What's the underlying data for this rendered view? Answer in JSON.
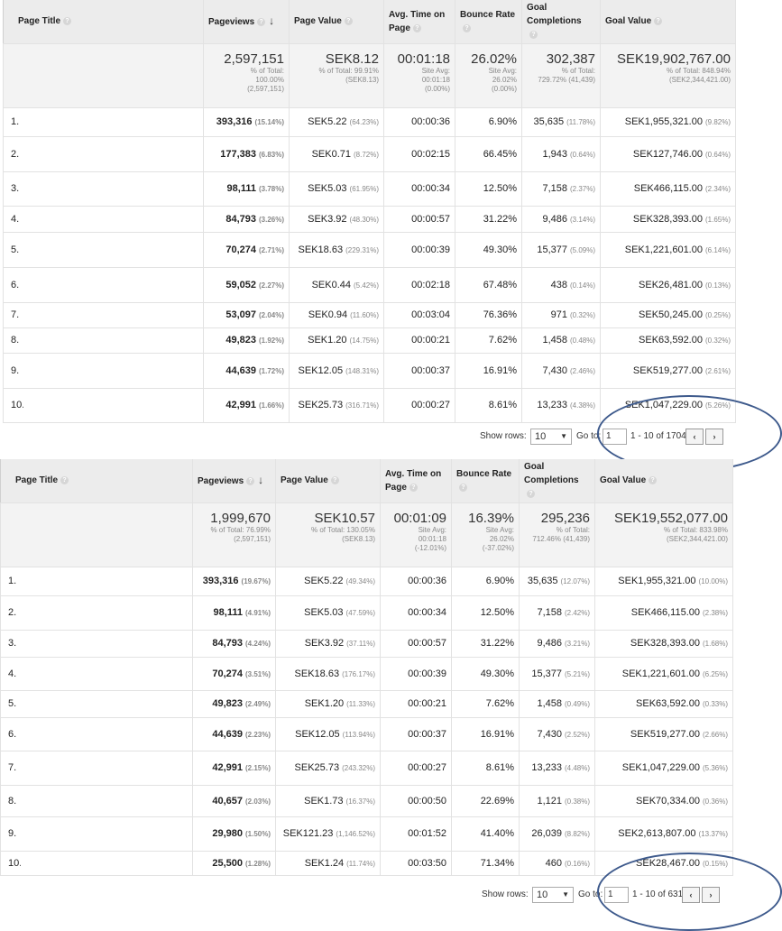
{
  "headers": {
    "page_title": "Page Title",
    "pageviews": "Pageviews",
    "page_value": "Page Value",
    "avg_time": "Avg. Time on Page",
    "bounce_rate": "Bounce Rate",
    "goal_completions": "Goal Completions",
    "goal_value": "Goal Value",
    "help_icon": "?",
    "sort_icon": "↓"
  },
  "colors": {
    "circle": "#3e5a8c",
    "header_bg": "#ececec",
    "summary_bg": "#f3f3f3"
  },
  "table1": {
    "summary": {
      "pageviews": "2,597,151",
      "pageviews_sub1": "% of Total:",
      "pageviews_sub2": "100.00%",
      "pageviews_sub3": "(2,597,151)",
      "page_value": "SEK8.12",
      "page_value_sub1": "% of Total: 99.91%",
      "page_value_sub2": "(SEK8.13)",
      "avg_time": "00:01:18",
      "avg_time_sub1": "Site Avg:",
      "avg_time_sub2": "00:01:18",
      "avg_time_sub3": "(0.00%)",
      "bounce": "26.02%",
      "bounce_sub1": "Site Avg:",
      "bounce_sub2": "26.02%",
      "bounce_sub3": "(0.00%)",
      "goals": "302,387",
      "goals_sub1": "% of Total:",
      "goals_sub2": "729.72% (41,439)",
      "goal_value": "SEK19,902,767.00",
      "goal_value_sub1": "% of Total: 848.94%",
      "goal_value_sub2": "(SEK2,344,421.00)"
    },
    "rows": [
      {
        "idx": "1.",
        "pv": "393,316",
        "pv_pct": "(15.14%)",
        "val": "SEK5.22",
        "val_pct": "(64.23%)",
        "time": "00:00:36",
        "bounce": "6.90%",
        "goals": "35,635",
        "goals_pct": "(11.78%)",
        "gv": "SEK1,955,321.00",
        "gv_pct": "(9.82%)"
      },
      {
        "idx": "2.",
        "pv": "177,383",
        "pv_pct": "(6.83%)",
        "val": "SEK0.71",
        "val_pct": "(8.72%)",
        "time": "00:02:15",
        "bounce": "66.45%",
        "goals": "1,943",
        "goals_pct": "(0.64%)",
        "gv": "SEK127,746.00",
        "gv_pct": "(0.64%)"
      },
      {
        "idx": "3.",
        "pv": "98,111",
        "pv_pct": "(3.78%)",
        "val": "SEK5.03",
        "val_pct": "(61.95%)",
        "time": "00:00:34",
        "bounce": "12.50%",
        "goals": "7,158",
        "goals_pct": "(2.37%)",
        "gv": "SEK466,115.00",
        "gv_pct": "(2.34%)"
      },
      {
        "idx": "4.",
        "pv": "84,793",
        "pv_pct": "(3.26%)",
        "val": "SEK3.92",
        "val_pct": "(48.30%)",
        "time": "00:00:57",
        "bounce": "31.22%",
        "goals": "9,486",
        "goals_pct": "(3.14%)",
        "gv": "SEK328,393.00",
        "gv_pct": "(1.65%)"
      },
      {
        "idx": "5.",
        "pv": "70,274",
        "pv_pct": "(2.71%)",
        "val": "SEK18.63",
        "val_pct": "(229.31%)",
        "time": "00:00:39",
        "bounce": "49.30%",
        "goals": "15,377",
        "goals_pct": "(5.09%)",
        "gv": "SEK1,221,601.00",
        "gv_pct": "(6.14%)"
      },
      {
        "idx": "6.",
        "pv": "59,052",
        "pv_pct": "(2.27%)",
        "val": "SEK0.44",
        "val_pct": "(5.42%)",
        "time": "00:02:18",
        "bounce": "67.48%",
        "goals": "438",
        "goals_pct": "(0.14%)",
        "gv": "SEK26,481.00",
        "gv_pct": "(0.13%)"
      },
      {
        "idx": "7.",
        "pv": "53,097",
        "pv_pct": "(2.04%)",
        "val": "SEK0.94",
        "val_pct": "(11.60%)",
        "time": "00:03:04",
        "bounce": "76.36%",
        "goals": "971",
        "goals_pct": "(0.32%)",
        "gv": "SEK50,245.00",
        "gv_pct": "(0.25%)"
      },
      {
        "idx": "8.",
        "pv": "49,823",
        "pv_pct": "(1.92%)",
        "val": "SEK1.20",
        "val_pct": "(14.75%)",
        "time": "00:00:21",
        "bounce": "7.62%",
        "goals": "1,458",
        "goals_pct": "(0.48%)",
        "gv": "SEK63,592.00",
        "gv_pct": "(0.32%)"
      },
      {
        "idx": "9.",
        "pv": "44,639",
        "pv_pct": "(1.72%)",
        "val": "SEK12.05",
        "val_pct": "(148.31%)",
        "time": "00:00:37",
        "bounce": "16.91%",
        "goals": "7,430",
        "goals_pct": "(2.46%)",
        "gv": "SEK519,277.00",
        "gv_pct": "(2.61%)"
      },
      {
        "idx": "10.",
        "pv": "42,991",
        "pv_pct": "(1.66%)",
        "val": "SEK25.73",
        "val_pct": "(316.71%)",
        "time": "00:00:27",
        "bounce": "8.61%",
        "goals": "13,233",
        "goals_pct": "(4.38%)",
        "gv": "SEK1,047,229.00",
        "gv_pct": "(5.26%)"
      }
    ],
    "pager": {
      "show_rows_label": "Show rows:",
      "rows_value": "10",
      "goto_label": "Go to:",
      "goto_value": "1",
      "range": "1 - 10 of 1704",
      "prev": "‹",
      "next": "›"
    }
  },
  "table2": {
    "summary": {
      "pageviews": "1,999,670",
      "pageviews_sub1": "% of Total: 76.99%",
      "pageviews_sub2": "(2,597,151)",
      "page_value": "SEK10.57",
      "page_value_sub1": "% of Total: 130.05%",
      "page_value_sub2": "(SEK8.13)",
      "avg_time": "00:01:09",
      "avg_time_sub1": "Site Avg:",
      "avg_time_sub2": "00:01:18",
      "avg_time_sub3": "(-12.01%)",
      "bounce": "16.39%",
      "bounce_sub1": "Site Avg:",
      "bounce_sub2": "26.02%",
      "bounce_sub3": "(-37.02%)",
      "goals": "295,236",
      "goals_sub1": "% of Total:",
      "goals_sub2": "712.46% (41,439)",
      "goal_value": "SEK19,552,077.00",
      "goal_value_sub1": "% of Total: 833.98%",
      "goal_value_sub2": "(SEK2,344,421.00)"
    },
    "rows": [
      {
        "idx": "1.",
        "pv": "393,316",
        "pv_pct": "(19.67%)",
        "val": "SEK5.22",
        "val_pct": "(49.34%)",
        "time": "00:00:36",
        "bounce": "6.90%",
        "goals": "35,635",
        "goals_pct": "(12.07%)",
        "gv": "SEK1,955,321.00",
        "gv_pct": "(10.00%)"
      },
      {
        "idx": "2.",
        "pv": "98,111",
        "pv_pct": "(4.91%)",
        "val": "SEK5.03",
        "val_pct": "(47.59%)",
        "time": "00:00:34",
        "bounce": "12.50%",
        "goals": "7,158",
        "goals_pct": "(2.42%)",
        "gv": "SEK466,115.00",
        "gv_pct": "(2.38%)"
      },
      {
        "idx": "3.",
        "pv": "84,793",
        "pv_pct": "(4.24%)",
        "val": "SEK3.92",
        "val_pct": "(37.11%)",
        "time": "00:00:57",
        "bounce": "31.22%",
        "goals": "9,486",
        "goals_pct": "(3.21%)",
        "gv": "SEK328,393.00",
        "gv_pct": "(1.68%)"
      },
      {
        "idx": "4.",
        "pv": "70,274",
        "pv_pct": "(3.51%)",
        "val": "SEK18.63",
        "val_pct": "(176.17%)",
        "time": "00:00:39",
        "bounce": "49.30%",
        "goals": "15,377",
        "goals_pct": "(5.21%)",
        "gv": "SEK1,221,601.00",
        "gv_pct": "(6.25%)"
      },
      {
        "idx": "5.",
        "pv": "49,823",
        "pv_pct": "(2.49%)",
        "val": "SEK1.20",
        "val_pct": "(11.33%)",
        "time": "00:00:21",
        "bounce": "7.62%",
        "goals": "1,458",
        "goals_pct": "(0.49%)",
        "gv": "SEK63,592.00",
        "gv_pct": "(0.33%)"
      },
      {
        "idx": "6.",
        "pv": "44,639",
        "pv_pct": "(2.23%)",
        "val": "SEK12.05",
        "val_pct": "(113.94%)",
        "time": "00:00:37",
        "bounce": "16.91%",
        "goals": "7,430",
        "goals_pct": "(2.52%)",
        "gv": "SEK519,277.00",
        "gv_pct": "(2.66%)"
      },
      {
        "idx": "7.",
        "pv": "42,991",
        "pv_pct": "(2.15%)",
        "val": "SEK25.73",
        "val_pct": "(243.32%)",
        "time": "00:00:27",
        "bounce": "8.61%",
        "goals": "13,233",
        "goals_pct": "(4.48%)",
        "gv": "SEK1,047,229.00",
        "gv_pct": "(5.36%)"
      },
      {
        "idx": "8.",
        "pv": "40,657",
        "pv_pct": "(2.03%)",
        "val": "SEK1.73",
        "val_pct": "(16.37%)",
        "time": "00:00:50",
        "bounce": "22.69%",
        "goals": "1,121",
        "goals_pct": "(0.38%)",
        "gv": "SEK70,334.00",
        "gv_pct": "(0.36%)"
      },
      {
        "idx": "9.",
        "pv": "29,980",
        "pv_pct": "(1.50%)",
        "val": "SEK121.23",
        "val_pct": "(1,146.52%)",
        "time": "00:01:52",
        "bounce": "41.40%",
        "goals": "26,039",
        "goals_pct": "(8.82%)",
        "gv": "SEK2,613,807.00",
        "gv_pct": "(13.37%)"
      },
      {
        "idx": "10.",
        "pv": "25,500",
        "pv_pct": "(1.28%)",
        "val": "SEK1.24",
        "val_pct": "(11.74%)",
        "time": "00:03:50",
        "bounce": "71.34%",
        "goals": "460",
        "goals_pct": "(0.16%)",
        "gv": "SEK28,467.00",
        "gv_pct": "(0.15%)"
      }
    ],
    "pager": {
      "show_rows_label": "Show rows:",
      "rows_value": "10",
      "goto_label": "Go to:",
      "goto_value": "1",
      "range": "1 - 10 of 631",
      "prev": "‹",
      "next": "›"
    }
  }
}
